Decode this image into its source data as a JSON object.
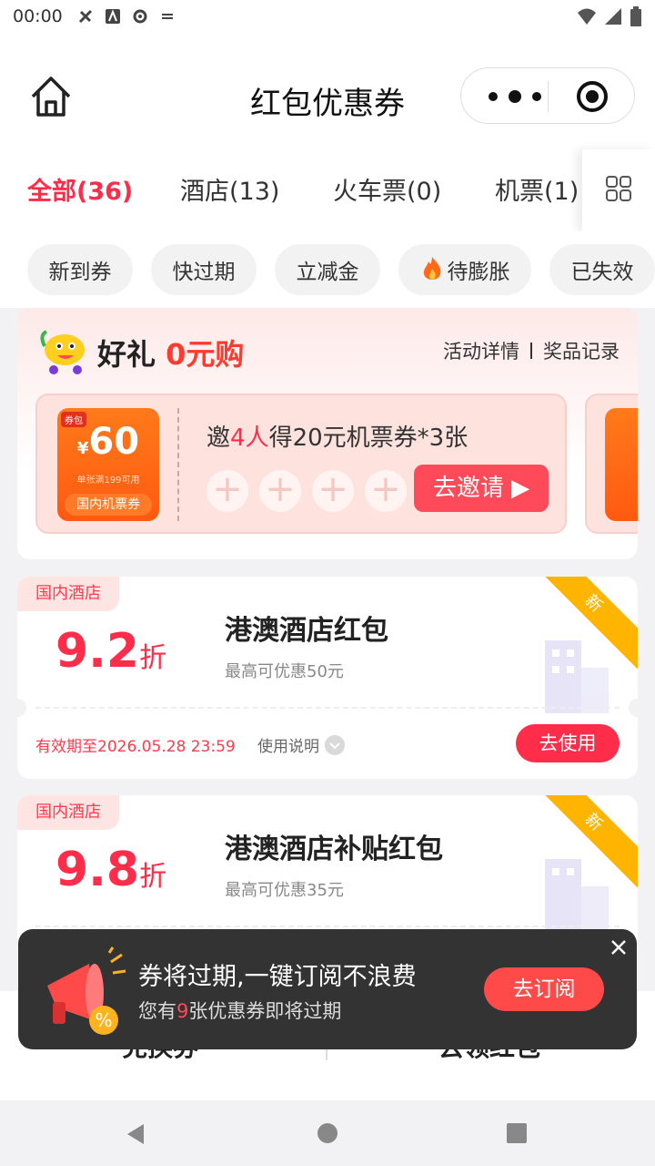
{
  "status_bar": {
    "time": "00:00"
  },
  "header": {
    "title": "红包优惠券"
  },
  "tabs": [
    {
      "label": "全部(36)"
    },
    {
      "label": "酒店(13)"
    },
    {
      "label": "火车票(0)"
    },
    {
      "label": "机票(1)"
    }
  ],
  "chips": [
    {
      "label": "新到券"
    },
    {
      "label": "快过期"
    },
    {
      "label": "立减金"
    },
    {
      "label": "待膨胀"
    },
    {
      "label": "已失效"
    }
  ],
  "promo": {
    "title_a": "好礼",
    "title_b": "0元购",
    "link_details": "活动详情",
    "link_records": "奖品记录",
    "coupon": {
      "tag": "券包",
      "currency": "¥",
      "amount": "60",
      "condition": "单张满199可用",
      "kind": "国内机票券"
    },
    "invite_a": "邀",
    "invite_count": "4人",
    "invite_b": "得20元机票券*3张",
    "invite_button": "去邀请 ▶"
  },
  "coupons": [
    {
      "tag": "国内酒店",
      "discount": "9.2",
      "unit": "折",
      "name": "港澳酒店红包",
      "desc": "最高可优惠50元",
      "ribbon": "新",
      "valid": "有效期至2026.05.28 23:59",
      "howto": "使用说明",
      "button": "去使用"
    },
    {
      "tag": "国内酒店",
      "discount": "9.8",
      "unit": "折",
      "name": "港澳酒店补贴红包",
      "desc": "最高可优惠35元",
      "ribbon": "新"
    }
  ],
  "bottom": {
    "exchange": "兑换券",
    "get_red": "去领红包",
    "arrows": "›››"
  },
  "toast": {
    "title": "券将过期,一键订阅不浪费",
    "line_a": "您有",
    "line_count": "9",
    "line_b": "张优惠券即将过期",
    "button": "去订阅"
  }
}
